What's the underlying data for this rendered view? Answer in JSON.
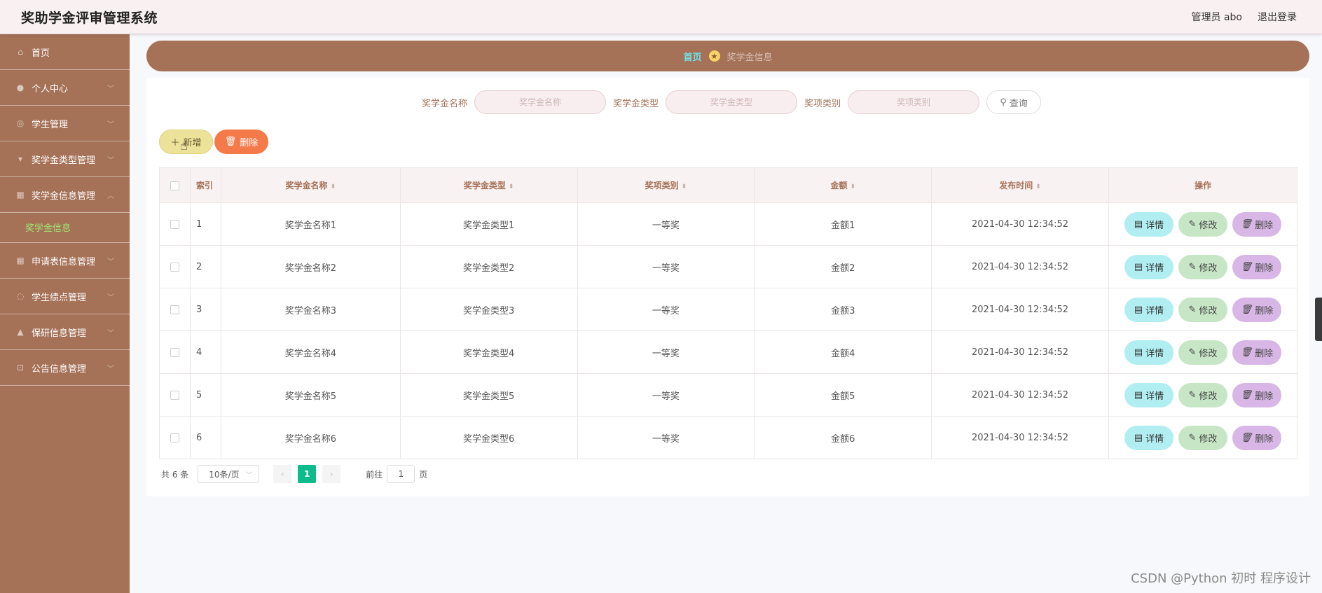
{
  "header": {
    "title": "奖助学金评审管理系统",
    "user_label": "管理员 abo",
    "logout_label": "退出登录"
  },
  "sidebar": {
    "items": [
      {
        "label": "首页",
        "icon": "home-icon",
        "glyph": "⌂"
      },
      {
        "label": "个人中心",
        "icon": "user-icon",
        "glyph": "●"
      },
      {
        "label": "学生管理",
        "icon": "globe-icon",
        "glyph": "◎"
      },
      {
        "label": "奖学金类型管理",
        "icon": "trophy-icon",
        "glyph": "▾"
      },
      {
        "label": "奖学金信息管理",
        "icon": "grid-icon",
        "glyph": "▦"
      },
      {
        "label": "申请表信息管理",
        "icon": "table-icon",
        "glyph": "▦"
      },
      {
        "label": "学生绩点管理",
        "icon": "loading-icon",
        "glyph": "◌"
      },
      {
        "label": "保研信息管理",
        "icon": "bank-icon",
        "glyph": "▲"
      },
      {
        "label": "公告信息管理",
        "icon": "crop-icon",
        "glyph": "⊡"
      }
    ],
    "submenu_active": "奖学金信息"
  },
  "breadcrumb": {
    "home": "首页",
    "current": "奖学金信息"
  },
  "search": {
    "name_label": "奖学金名称",
    "name_placeholder": "奖学金名称",
    "type_label": "奖学金类型",
    "type_placeholder": "奖学金类型",
    "category_label": "奖项类别",
    "category_placeholder": "奖项类别",
    "query_label": "查询"
  },
  "actions": {
    "add_label": "新增",
    "delete_label": "删除"
  },
  "table": {
    "headers": {
      "index": "索引",
      "name": "奖学金名称",
      "type": "奖学金类型",
      "category": "奖项类别",
      "amount": "金额",
      "time": "发布时间",
      "ops": "操作"
    },
    "rows": [
      {
        "index": "1",
        "name": "奖学金名称1",
        "type": "奖学金类型1",
        "category": "一等奖",
        "amount": "金额1",
        "time": "2021-04-30 12:34:52"
      },
      {
        "index": "2",
        "name": "奖学金名称2",
        "type": "奖学金类型2",
        "category": "一等奖",
        "amount": "金额2",
        "time": "2021-04-30 12:34:52"
      },
      {
        "index": "3",
        "name": "奖学金名称3",
        "type": "奖学金类型3",
        "category": "一等奖",
        "amount": "金额3",
        "time": "2021-04-30 12:34:52"
      },
      {
        "index": "4",
        "name": "奖学金名称4",
        "type": "奖学金类型4",
        "category": "一等奖",
        "amount": "金额4",
        "time": "2021-04-30 12:34:52"
      },
      {
        "index": "5",
        "name": "奖学金名称5",
        "type": "奖学金类型5",
        "category": "一等奖",
        "amount": "金额5",
        "time": "2021-04-30 12:34:52"
      },
      {
        "index": "6",
        "name": "奖学金名称6",
        "type": "奖学金类型6",
        "category": "一等奖",
        "amount": "金额6",
        "time": "2021-04-30 12:34:52"
      }
    ],
    "row_actions": {
      "detail": "详情",
      "edit": "修改",
      "delete": "删除"
    }
  },
  "pagination": {
    "total": "共 6 条",
    "page_size": "10条/页",
    "current_page": "1",
    "goto_label": "前往",
    "goto_value": "1",
    "page_unit": "页"
  },
  "watermark": "CSDN @Python 初时 程序设计",
  "colors": {
    "sidebar": "#a57157",
    "header": "#f9f0f1",
    "accent_green": "#0dbc8b",
    "add_button": "#ede29a",
    "delete_button": "#f57a4a"
  }
}
